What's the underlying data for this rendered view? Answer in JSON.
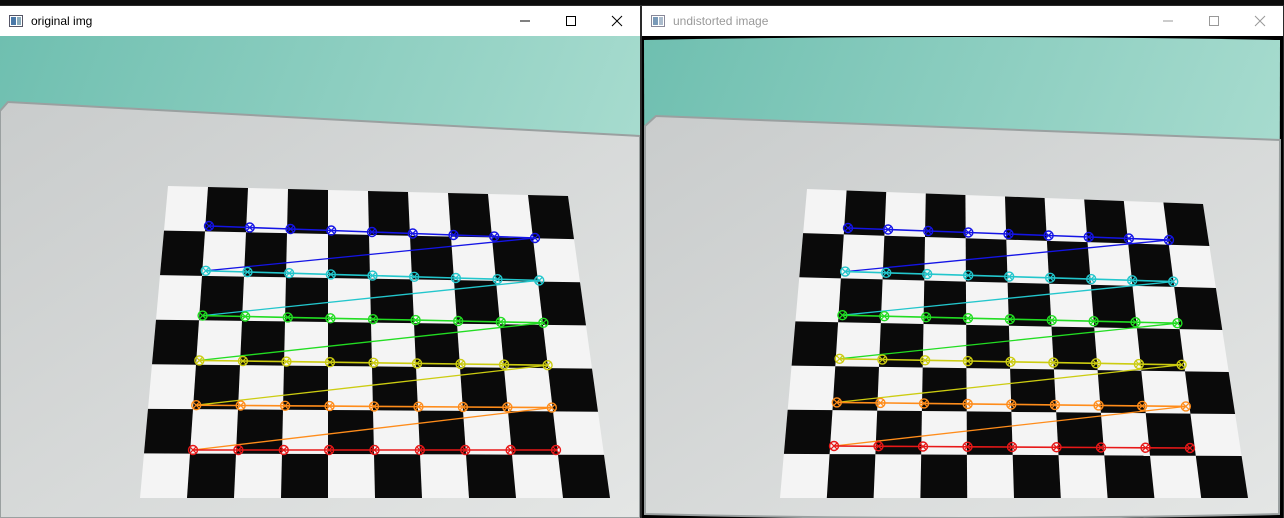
{
  "windows": [
    {
      "title": "original img",
      "controls": {
        "minimize_icon": "minimize-icon",
        "maximize_icon": "maximize-icon",
        "close_icon": "close-icon"
      },
      "content_icon": "checkerboard-image"
    },
    {
      "title": "undistorted image",
      "controls": {
        "minimize_icon": "minimize-icon",
        "maximize_icon": "maximize-icon",
        "close_icon": "close-icon"
      },
      "content_icon": "checkerboard-image"
    }
  ],
  "pattern": {
    "rows": 6,
    "cols": 9,
    "row_colors": [
      "#1414e6",
      "#22c6cc",
      "#22dd22",
      "#cccc10",
      "#ff8c1a",
      "#e81818"
    ]
  }
}
